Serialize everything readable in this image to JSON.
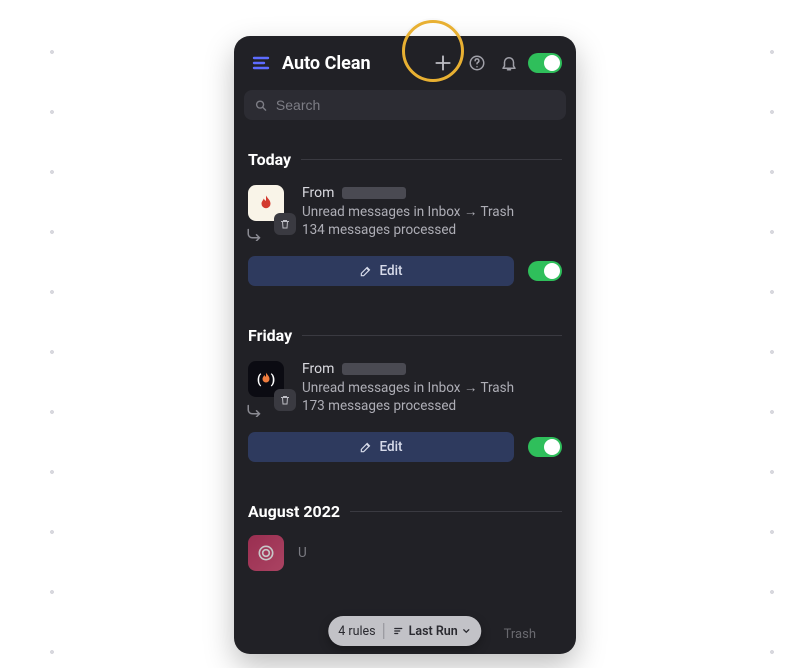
{
  "header": {
    "title": "Auto Clean",
    "master_toggle_on": true
  },
  "search": {
    "placeholder": "Search"
  },
  "sections": [
    {
      "title": "Today",
      "rule": {
        "from_label": "From",
        "desc": "Unread messages in Inbox → Trash",
        "count": "134 messages processed",
        "edit_label": "Edit",
        "toggle_on": true
      }
    },
    {
      "title": "Friday",
      "rule": {
        "from_label": "From",
        "desc": "Unread messages in Inbox → Trash",
        "count": "173 messages processed",
        "edit_label": "Edit",
        "toggle_on": true
      }
    },
    {
      "title": "August 2022",
      "rule": {
        "partial_text": "U",
        "trailing": "Trash"
      }
    }
  ],
  "footer": {
    "rules_count": "4 rules",
    "sort_label": "Last Run"
  },
  "colors": {
    "panel_bg": "#212126",
    "toggle_green": "#2fbf5b",
    "edit_btn": "#2e3a5e",
    "highlight": "#e8b032"
  }
}
